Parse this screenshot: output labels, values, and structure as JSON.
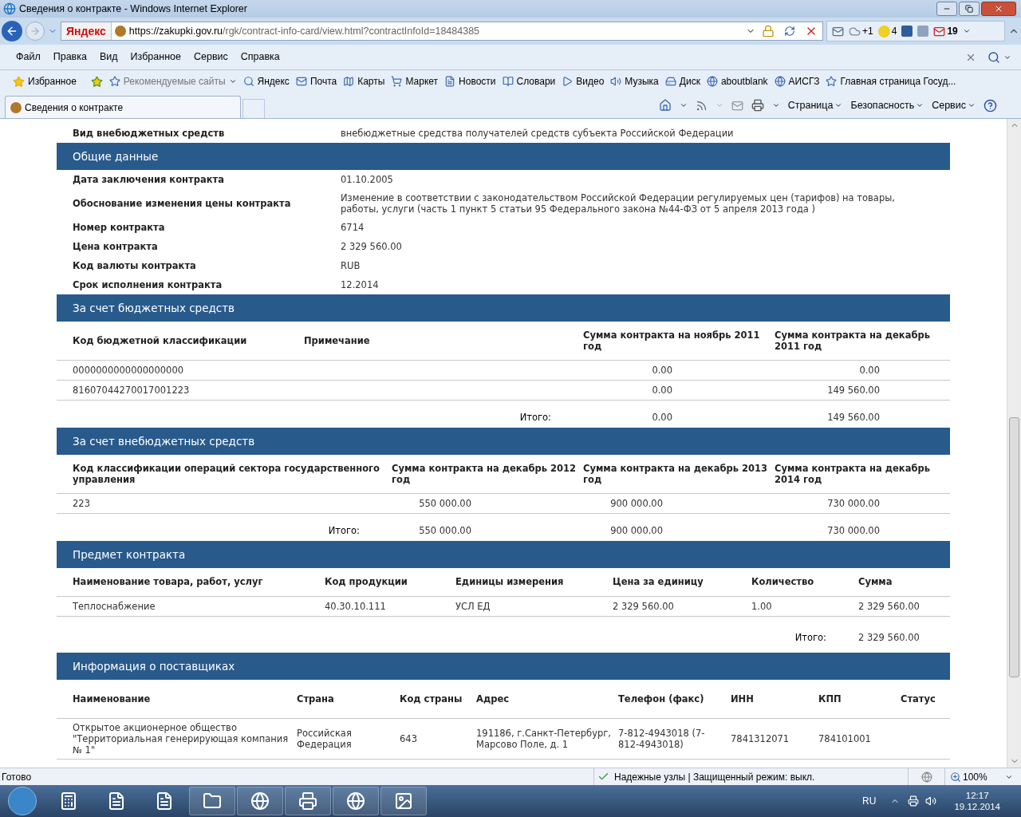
{
  "window": {
    "title": "Сведения о контракте - Windows Internet Explorer"
  },
  "address": {
    "search_engine": "Яндекс",
    "url_host": "https://zakupki.gov.ru",
    "url_path": "/rgk/contract-info-card/view.html?contractInfoId=18484385"
  },
  "addons": [
    {
      "count": "+1"
    },
    {
      "count": "4"
    },
    {
      "count": "19"
    }
  ],
  "menu": [
    "Файл",
    "Правка",
    "Вид",
    "Избранное",
    "Сервис",
    "Справка"
  ],
  "favorites": {
    "label": "Избранное",
    "links": [
      "Рекомендуемые сайты",
      "Яндекс",
      "Почта",
      "Карты",
      "Маркет",
      "Новости",
      "Словари",
      "Видео",
      "Музыка",
      "Диск",
      "aboutblank",
      "АИСГЗ",
      "Главная страница  Госуд..."
    ]
  },
  "tabs": [
    {
      "label": "Сведения о контракте",
      "selected": true
    }
  ],
  "commands": [
    "Страница",
    "Безопасность",
    "Сервис"
  ],
  "content": [
    {
      "kind": "fields",
      "rows": [
        {
          "label": "Вид внебюджетных средств",
          "value": "внебюджетные средства получателей средств субъекта Российской Федерации"
        }
      ]
    },
    {
      "kind": "header",
      "title": "Общие данные"
    },
    {
      "kind": "fields",
      "rows": [
        {
          "label": "Дата заключения контракта",
          "value": "01.10.2005"
        },
        {
          "label": "Обоснование изменения цены контракта",
          "value": "Изменение в соответствии с законодательством Российской Федерации регулируемых цен (тарифов) на товары, работы, услуги (часть 1 пункт 5 статьи 95 Федерального закона №44-ФЗ от 5 апреля 2013 года )"
        },
        {
          "label": "Номер контракта",
          "value": "6714"
        },
        {
          "label": "Цена контракта",
          "value": "2 329 560.00"
        },
        {
          "label": "Код валюты контракта",
          "value": "RUB"
        },
        {
          "label": "Срок исполнения контракта",
          "value": "12.2014"
        }
      ]
    },
    {
      "kind": "header",
      "title": "За счет бюджетных средств"
    },
    {
      "kind": "table",
      "columns": [
        {
          "label": "Код бюджетной классификации"
        },
        {
          "label": "Примечание"
        },
        {
          "label": "Сумма контракта на ноябрь 2011 год"
        },
        {
          "label": "Сумма контракта на декабрь 2011 год"
        }
      ],
      "rows": [
        [
          "0000000000000000000",
          "",
          "0.00",
          "0.00"
        ],
        [
          "81607044270017001223",
          "",
          "0.00",
          "149 560.00"
        ]
      ],
      "total": {
        "label": "Итого:",
        "values": [
          "0.00",
          "149 560.00"
        ]
      }
    },
    {
      "kind": "header",
      "title": "За счет внебюджетных средств"
    },
    {
      "kind": "table",
      "columns": [
        {
          "label": "Код классификации операций сектора государственного управления"
        },
        {
          "label": "Сумма контракта на декабрь 2012 год"
        },
        {
          "label": "Сумма контракта на декабрь 2013 год"
        },
        {
          "label": "Сумма контракта на декабрь 2014 год"
        }
      ],
      "rows": [
        [
          "223",
          "550 000.00",
          "900 000.00",
          "730 000.00"
        ]
      ],
      "total": {
        "label": "Итого:",
        "values": [
          "550 000.00",
          "900 000.00",
          "730 000.00"
        ]
      }
    },
    {
      "kind": "header",
      "title": "Предмет контракта"
    },
    {
      "kind": "table",
      "columns": [
        {
          "label": "Наименование товара, работ, услуг"
        },
        {
          "label": "Код продукции"
        },
        {
          "label": "Единицы измерения"
        },
        {
          "label": "Цена за единицу"
        },
        {
          "label": "Количество"
        },
        {
          "label": "Сумма"
        }
      ],
      "rows": [
        [
          "Теплоснабжение",
          "40.30.10.111",
          "УСЛ ЕД",
          "2 329 560.00",
          "1.00",
          "2 329 560.00"
        ]
      ],
      "total": {
        "label": "Итого:",
        "values": [
          "2 329 560.00"
        ]
      }
    },
    {
      "kind": "header",
      "title": "Информация о поставщиках"
    },
    {
      "kind": "table",
      "columns": [
        {
          "label": "Наименование"
        },
        {
          "label": "Страна"
        },
        {
          "label": "Код страны"
        },
        {
          "label": "Адрес"
        },
        {
          "label": "Телефон (факс)"
        },
        {
          "label": "ИНН"
        },
        {
          "label": "КПП"
        },
        {
          "label": "Статус"
        }
      ],
      "rows": [
        [
          "Открытое акционерное общество \"Территориальная генерирующая компания № 1\"",
          "Российская Федерация",
          "643",
          "191186, г.Санкт-Петербург, Марсово Поле, д. 1",
          "7-812-4943018 (7-812-4943018)",
          "7841312071",
          "784101001",
          ""
        ]
      ]
    }
  ],
  "status_bar": {
    "text": "Готово",
    "zone": "Надежные узлы | Защищенный режим: выкл.",
    "zoom": "100%"
  },
  "taskbar": {
    "language": "RU",
    "time": "12:17",
    "date": "19.12.2014"
  }
}
